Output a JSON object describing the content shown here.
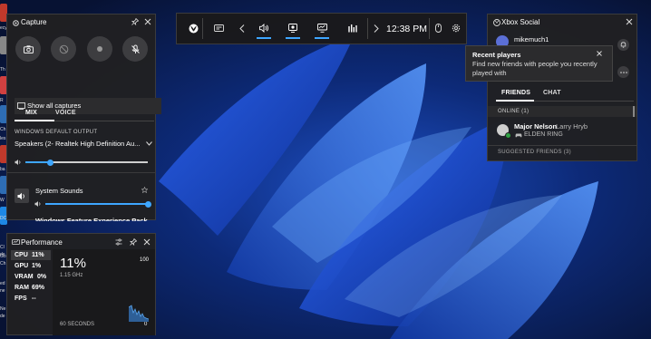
{
  "desktop": {
    "icon_labels": [
      "ecy",
      "Th",
      "R",
      "Ch",
      "les",
      "ba",
      "W",
      "DC",
      "Cl",
      "de",
      "Go",
      "Ch",
      "ed",
      "ne",
      "Ne",
      "de"
    ]
  },
  "game_bar": {
    "time": "12:38 PM",
    "buttons": [
      "xbox-logo-icon",
      "widget-menu-icon",
      "chevron-left-icon",
      "audio-icon",
      "capture-icon",
      "performance-icon",
      "resources-icon",
      "chevron-right-icon",
      "mouse-icon",
      "settings-icon"
    ]
  },
  "capture": {
    "title": "Capture",
    "show_all": "Show all captures",
    "tab_mix": "MIX",
    "tab_voice": "VOICE",
    "output_caption": "WINDOWS DEFAULT OUTPUT",
    "output_device": "Speakers (2- Realtek High Definition Au...",
    "master_volume": 0.2,
    "app1": "System Sounds",
    "app1_volume": 1.0,
    "app2": "Windows Feature Experience Pack"
  },
  "performance": {
    "title": "Performance",
    "rows": [
      {
        "label": "CPU",
        "value": "11%"
      },
      {
        "label": "GPU",
        "value": "1%"
      },
      {
        "label": "VRAM",
        "value": "0%"
      },
      {
        "label": "RAM",
        "value": "69%"
      },
      {
        "label": "FPS",
        "value": "--"
      }
    ],
    "big_value": "11%",
    "freq": "1.15 GHz",
    "max_label": "100",
    "min_label": "0",
    "duration": "60 SECONDS"
  },
  "social": {
    "title": "Xbox Social",
    "username": "mikemuch1",
    "tooltip_title": "Recent players",
    "tooltip_body": "Find new friends with people you recently played with",
    "tab_friends": "FRIENDS",
    "tab_chat": "CHAT",
    "online_header": "ONLINE (1)",
    "friend_gamertag": "Major Nelson",
    "friend_name": "Larry Hryb",
    "friend_game": "ELDEN RING",
    "suggested_header": "SUGGESTED FRIENDS (3)"
  },
  "colors": {
    "accent": "#3ea6ff",
    "panel": "#202022",
    "online": "#2ea043"
  }
}
